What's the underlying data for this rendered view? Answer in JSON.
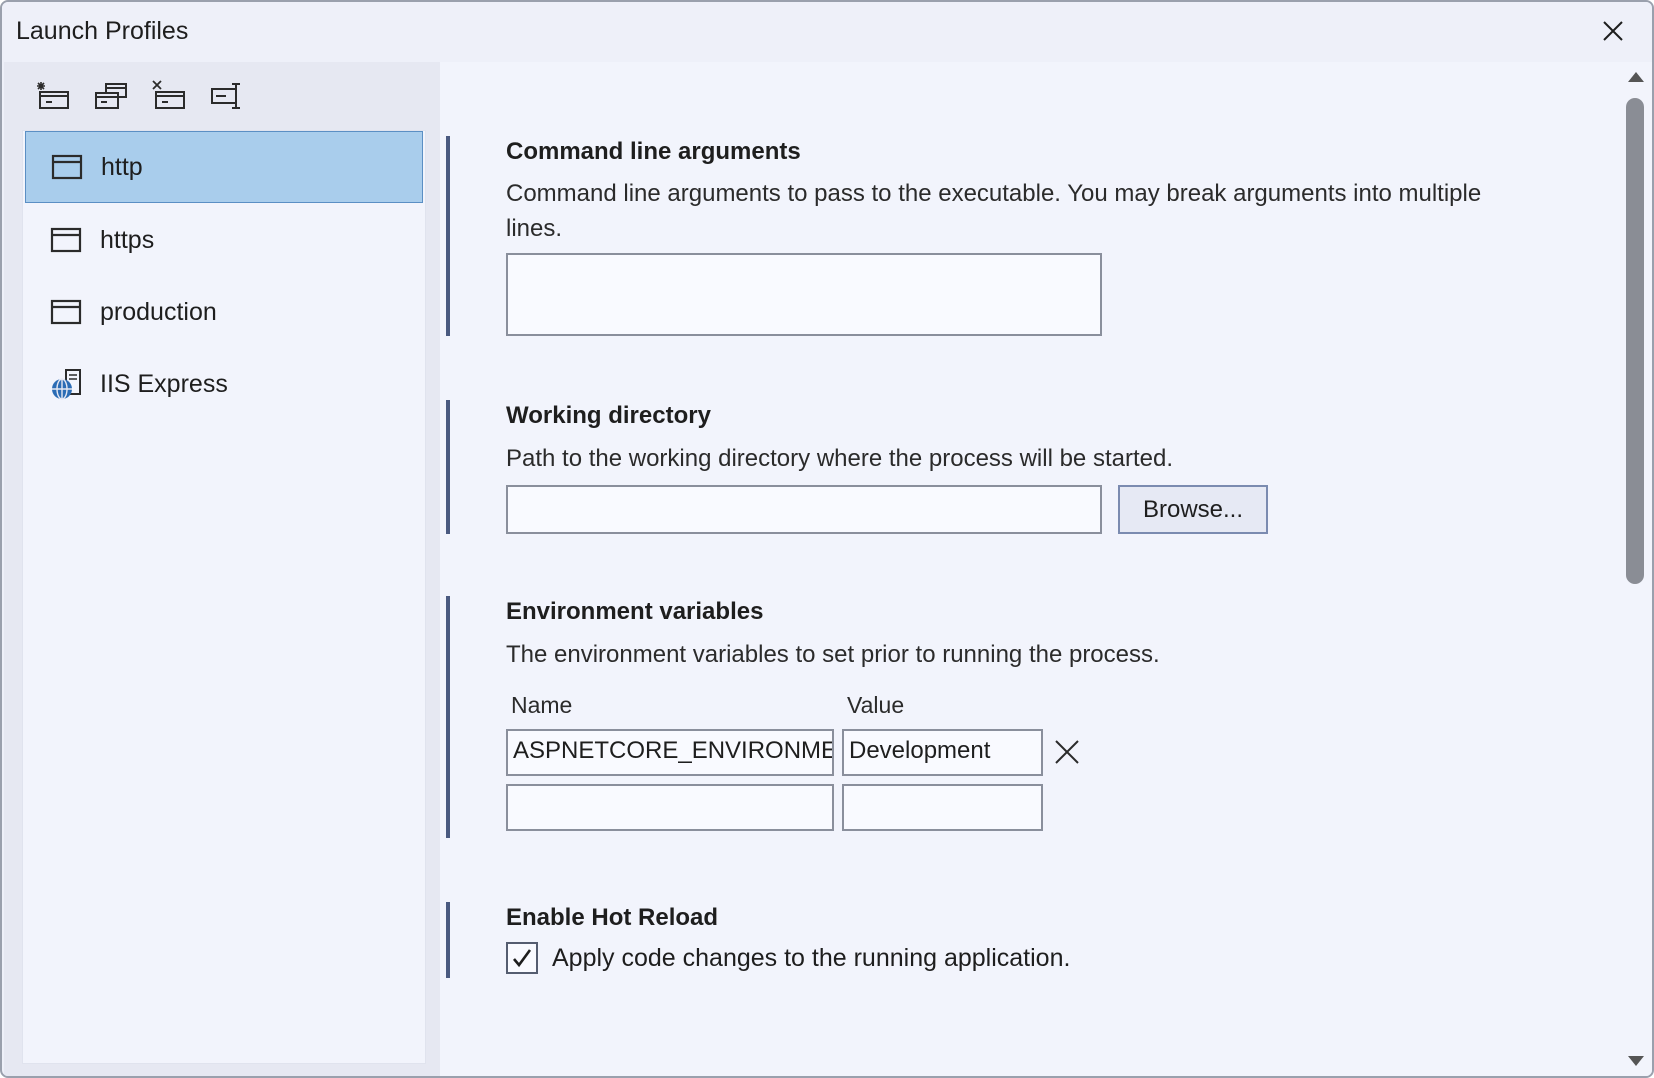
{
  "window": {
    "title": "Launch Profiles"
  },
  "toolbar": {
    "buttons": [
      {
        "icon": "new-profile-icon"
      },
      {
        "icon": "duplicate-profile-icon"
      },
      {
        "icon": "delete-profile-icon"
      },
      {
        "icon": "rename-profile-icon"
      }
    ]
  },
  "profiles": [
    {
      "label": "http",
      "icon": "window-icon",
      "selected": true
    },
    {
      "label": "https",
      "icon": "window-icon",
      "selected": false
    },
    {
      "label": "production",
      "icon": "window-icon",
      "selected": false
    },
    {
      "label": "IIS Express",
      "icon": "iis-globe-icon",
      "selected": false
    }
  ],
  "sections": {
    "cmdline": {
      "title": "Command line arguments",
      "description": "Command line arguments to pass to the executable. You may break arguments into multiple lines.",
      "value": ""
    },
    "workdir": {
      "title": "Working directory",
      "description": "Path to the working directory where the process will be started.",
      "value": "",
      "browse_label": "Browse..."
    },
    "env": {
      "title": "Environment variables",
      "description": "The environment variables to set prior to running the process.",
      "name_header": "Name",
      "value_header": "Value",
      "rows": [
        {
          "name": "ASPNETCORE_ENVIRONMENT",
          "value": "Development"
        },
        {
          "name": "",
          "value": ""
        }
      ]
    },
    "hotreload": {
      "title": "Enable Hot Reload",
      "checkbox_label": "Apply code changes to the running application.",
      "checked": true
    }
  }
}
